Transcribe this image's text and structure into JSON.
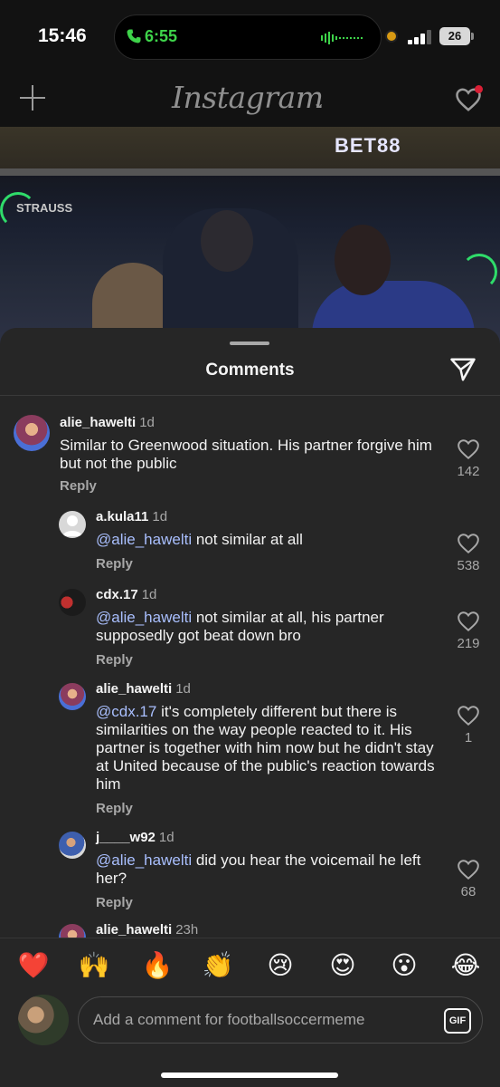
{
  "status_bar": {
    "time": "15:46",
    "call_time": "6:55",
    "battery": "26"
  },
  "header": {
    "logo": "Instagram",
    "accent": "#d91f35"
  },
  "video": {
    "banner_text": "STRAUSS",
    "sponsor_text": "BET88"
  },
  "sheet": {
    "title": "Comments"
  },
  "comments": [
    {
      "username": "alie_hawelti",
      "age": "1d",
      "mention": "",
      "text": "Similar to Greenwood situation. His partner forgive him but not the public",
      "reply": "Reply",
      "likes": "142"
    },
    {
      "username": "a.kula11",
      "age": "1d",
      "mention": "@alie_hawelti",
      "text": " not similar at all",
      "reply": "Reply",
      "likes": "538"
    },
    {
      "username": "cdx.17",
      "age": "1d",
      "mention": "@alie_hawelti",
      "text": " not similar at all, his partner supposedly got beat down bro",
      "reply": "Reply",
      "likes": "219"
    },
    {
      "username": "alie_hawelti",
      "age": "1d",
      "mention": "@cdx.17",
      "text": " it's completely different but there is similarities on the way people reacted to it. His partner is together with him now but he didn't stay at United because of the public's reaction towards him",
      "reply": "Reply",
      "likes": "1"
    },
    {
      "username": "j____w92",
      "age": "1d",
      "mention": "@alie_hawelti",
      "text": " did you hear the voicemail he left her?",
      "reply": "Reply",
      "likes": "68"
    },
    {
      "username": "alie_hawelti",
      "age": "23h"
    }
  ],
  "emoji_bar": [
    "❤️",
    "🙌",
    "🔥",
    "👏",
    "😢",
    "😍",
    "😮",
    "😂"
  ],
  "composer": {
    "placeholder": "Add a comment for footballsoccermeme",
    "gif_label": "GIF"
  }
}
